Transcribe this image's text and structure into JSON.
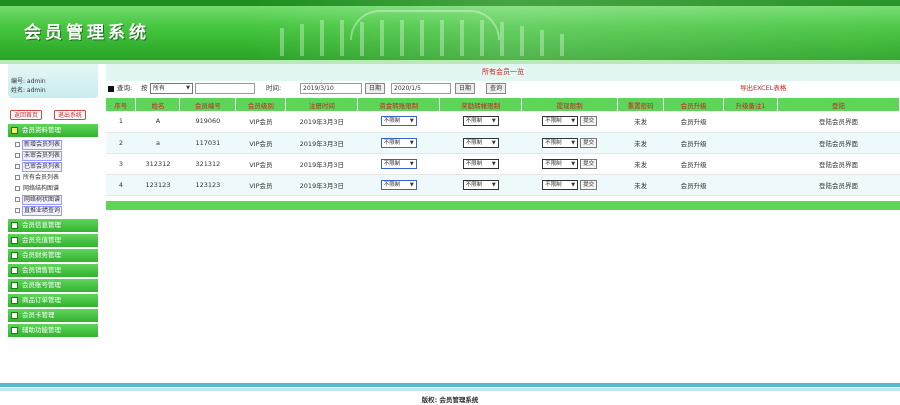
{
  "header": {
    "title": "会员管理系统"
  },
  "user": {
    "id_line": "编号: admin",
    "name_line": "姓名: admin"
  },
  "sidebar": {
    "home_button": "返回首页",
    "exit_button": "退出系统",
    "menus": [
      {
        "label": "会员资料管理",
        "open": true
      },
      {
        "label": "会员信息管理"
      },
      {
        "label": "会员充值管理"
      },
      {
        "label": "会员财务管理"
      },
      {
        "label": "会员销售管理"
      },
      {
        "label": "会员账号管理"
      },
      {
        "label": "商品订单管理"
      },
      {
        "label": "会员卡管理"
      },
      {
        "label": "辅助功能管理"
      }
    ],
    "subitems": [
      {
        "label": "新增会员列表",
        "highlight": true
      },
      {
        "label": "未审会员列表",
        "highlight": true
      },
      {
        "label": "已审会员列表",
        "highlight": true
      },
      {
        "label": "所有会员列表",
        "highlight": false
      },
      {
        "label": "网络结构图谱",
        "highlight": false
      },
      {
        "label": "网络树状图谱",
        "highlight": true
      },
      {
        "label": "直推业绩查询",
        "highlight": true
      }
    ]
  },
  "main": {
    "title": "所有会员一览",
    "filter": {
      "query_label": "查询:",
      "by_label": "按",
      "select_value": "所有",
      "search_value": "",
      "time_label": "时间:",
      "date_from": "2019/3/10",
      "date_label1": "日期",
      "date_to": "2020/1/5",
      "date_label2": "日期",
      "query_button": "查询",
      "export_label": "导出EXCEL表格"
    },
    "columns": [
      "序号",
      "姓名",
      "会员编号",
      "会员级别",
      "注册时间",
      "资金转账限制",
      "奖励转帐限制",
      "提现限制",
      "重置密码",
      "会员升级",
      "升级备注1",
      "登陆"
    ],
    "rows": [
      {
        "no": "1",
        "name": "A",
        "member_id": "919060",
        "level": "VIP会员",
        "date": "2019年3月3日",
        "transfer": "不限制",
        "reward": "不限制",
        "withdraw": "不限制",
        "submit": "提交",
        "reset": "未发",
        "upgrade": "会员升级",
        "note": "",
        "login": "登陆会员界面"
      },
      {
        "no": "2",
        "name": "a",
        "member_id": "117031",
        "level": "VIP会员",
        "date": "2019年3月3日",
        "transfer": "不限制",
        "reward": "不限制",
        "withdraw": "不限制",
        "submit": "提交",
        "reset": "未发",
        "upgrade": "会员升级",
        "note": "",
        "login": "登陆会员界面"
      },
      {
        "no": "3",
        "name": "312312",
        "member_id": "321312",
        "level": "VIP会员",
        "date": "2019年3月3日",
        "transfer": "不限制",
        "reward": "不限制",
        "withdraw": "不限制",
        "submit": "提交",
        "reset": "未发",
        "upgrade": "会员升级",
        "note": "",
        "login": "登陆会员界面"
      },
      {
        "no": "4",
        "name": "123123",
        "member_id": "123123",
        "level": "VIP会员",
        "date": "2019年3月3日",
        "transfer": "不限制",
        "reward": "不限制",
        "withdraw": "不限制",
        "submit": "提交",
        "reset": "未发",
        "upgrade": "会员升级",
        "note": "",
        "login": "登陆会员界面"
      }
    ]
  },
  "footer": {
    "copyright": "版权: 会员管理系统"
  },
  "colors": {
    "brand_green": "#45c63f",
    "header_red": "#c8202a",
    "accent_teal": "#56b8cf"
  }
}
